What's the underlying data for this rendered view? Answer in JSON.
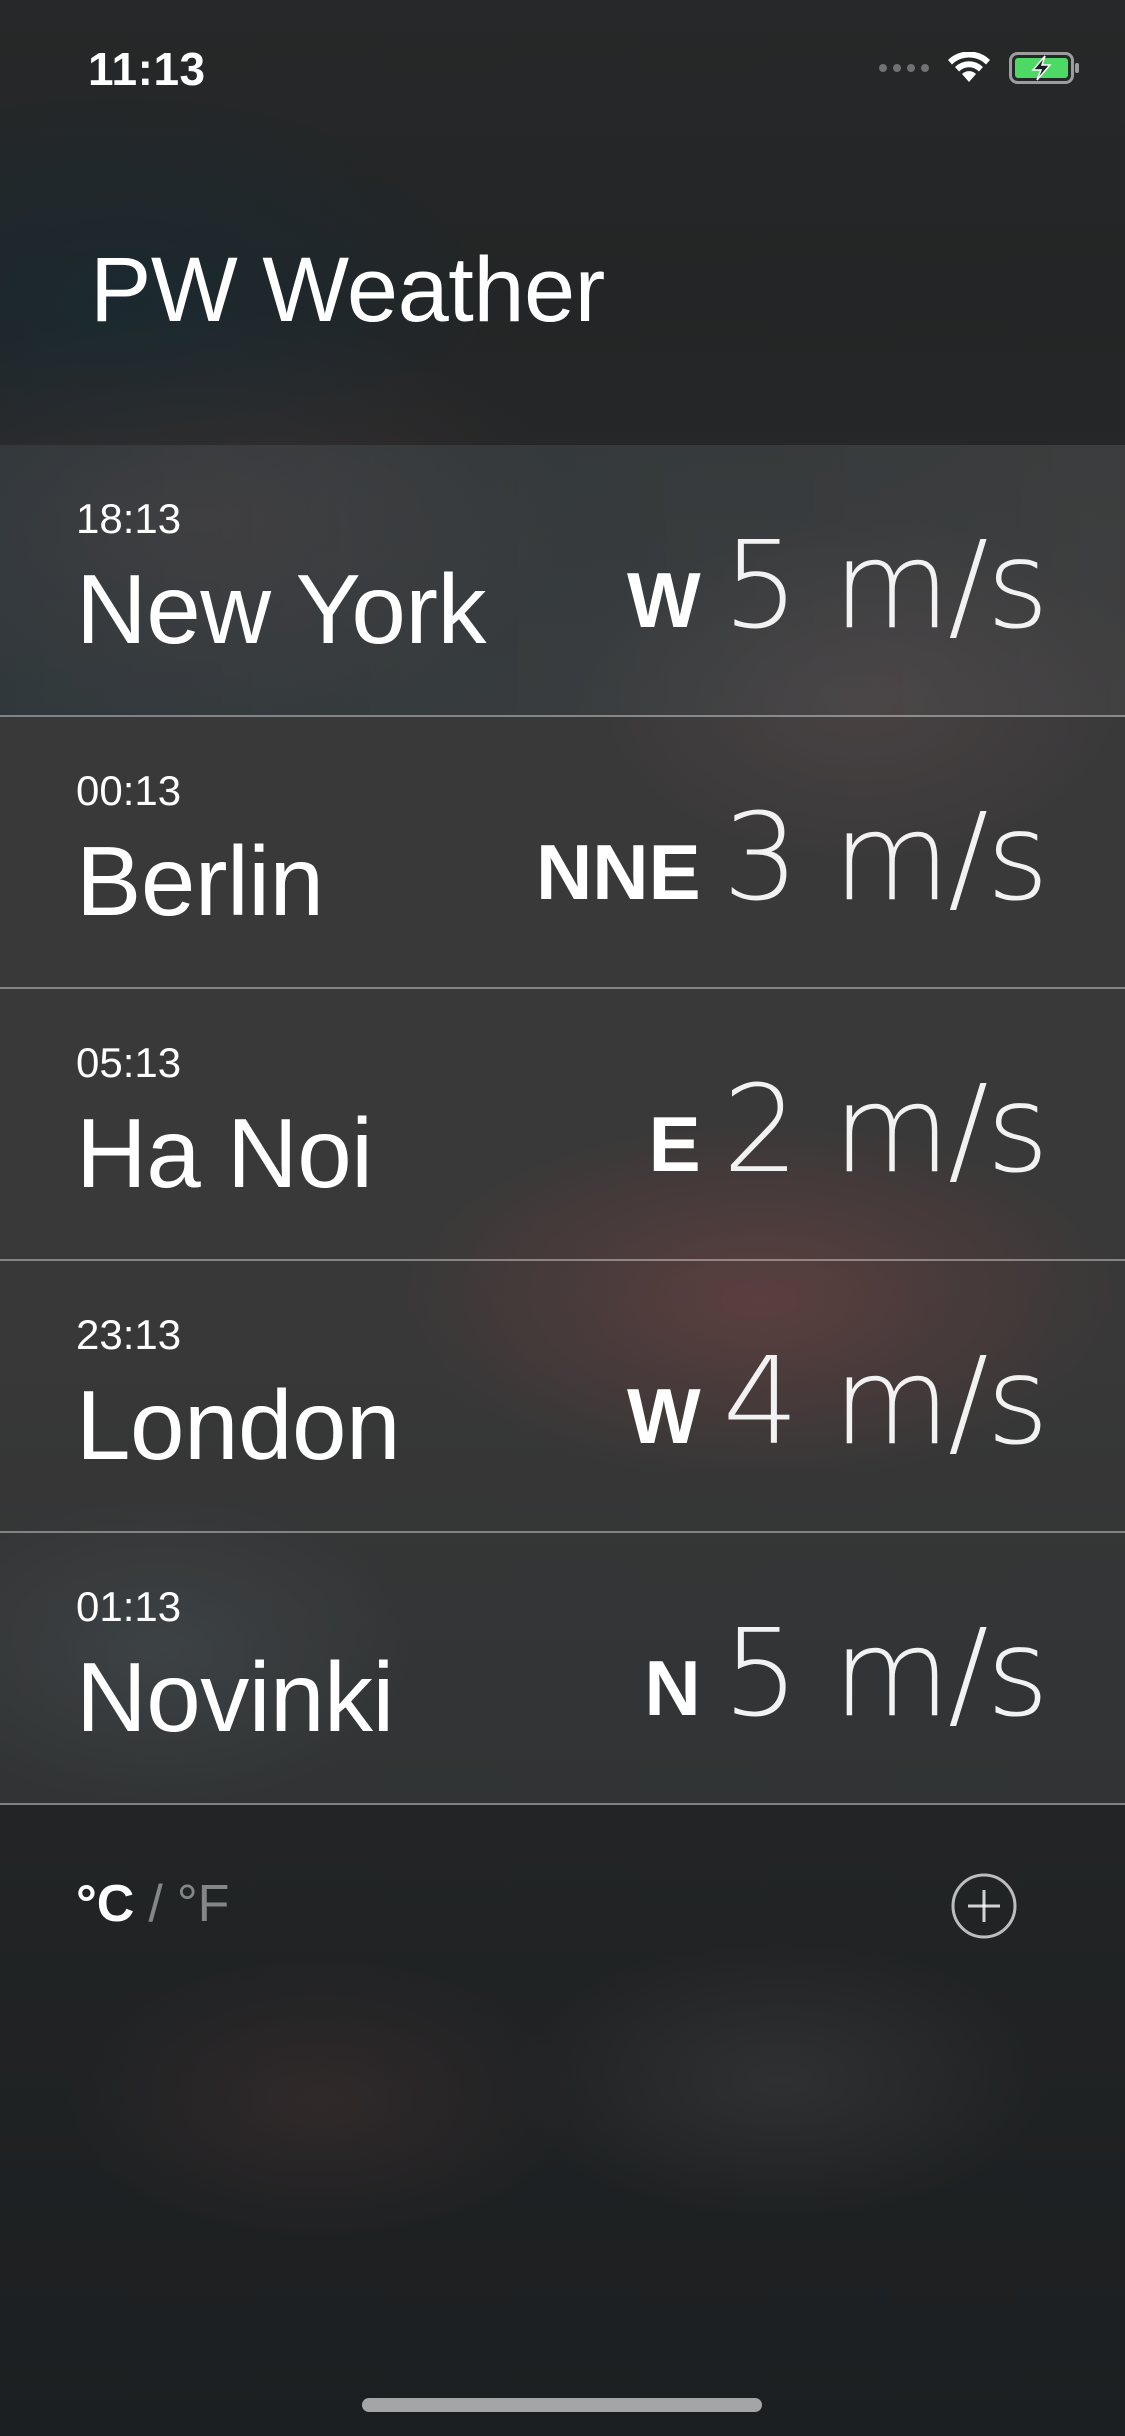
{
  "status_bar": {
    "time": "11:13",
    "icons": [
      "signal-icon",
      "wifi-icon",
      "battery-charging-icon"
    ],
    "battery_color": "#4cd964"
  },
  "header": {
    "title": "PW Weather"
  },
  "cities": [
    {
      "time": "18:13",
      "name": "New York",
      "wind_dir": "W",
      "wind_speed": "5 m/s"
    },
    {
      "time": "00:13",
      "name": "Berlin",
      "wind_dir": "NNE",
      "wind_speed": "3 m/s"
    },
    {
      "time": "05:13",
      "name": "Ha Noi",
      "wind_dir": "E",
      "wind_speed": "2 m/s"
    },
    {
      "time": "23:13",
      "name": "London",
      "wind_dir": "W",
      "wind_speed": "4 m/s"
    },
    {
      "time": "01:13",
      "name": "Novinki",
      "wind_dir": "N",
      "wind_speed": "5 m/s"
    }
  ],
  "footer": {
    "unit_celsius": "°C",
    "unit_separator": "/",
    "unit_fahrenheit": "°F",
    "add_icon": "plus-circle-icon"
  }
}
